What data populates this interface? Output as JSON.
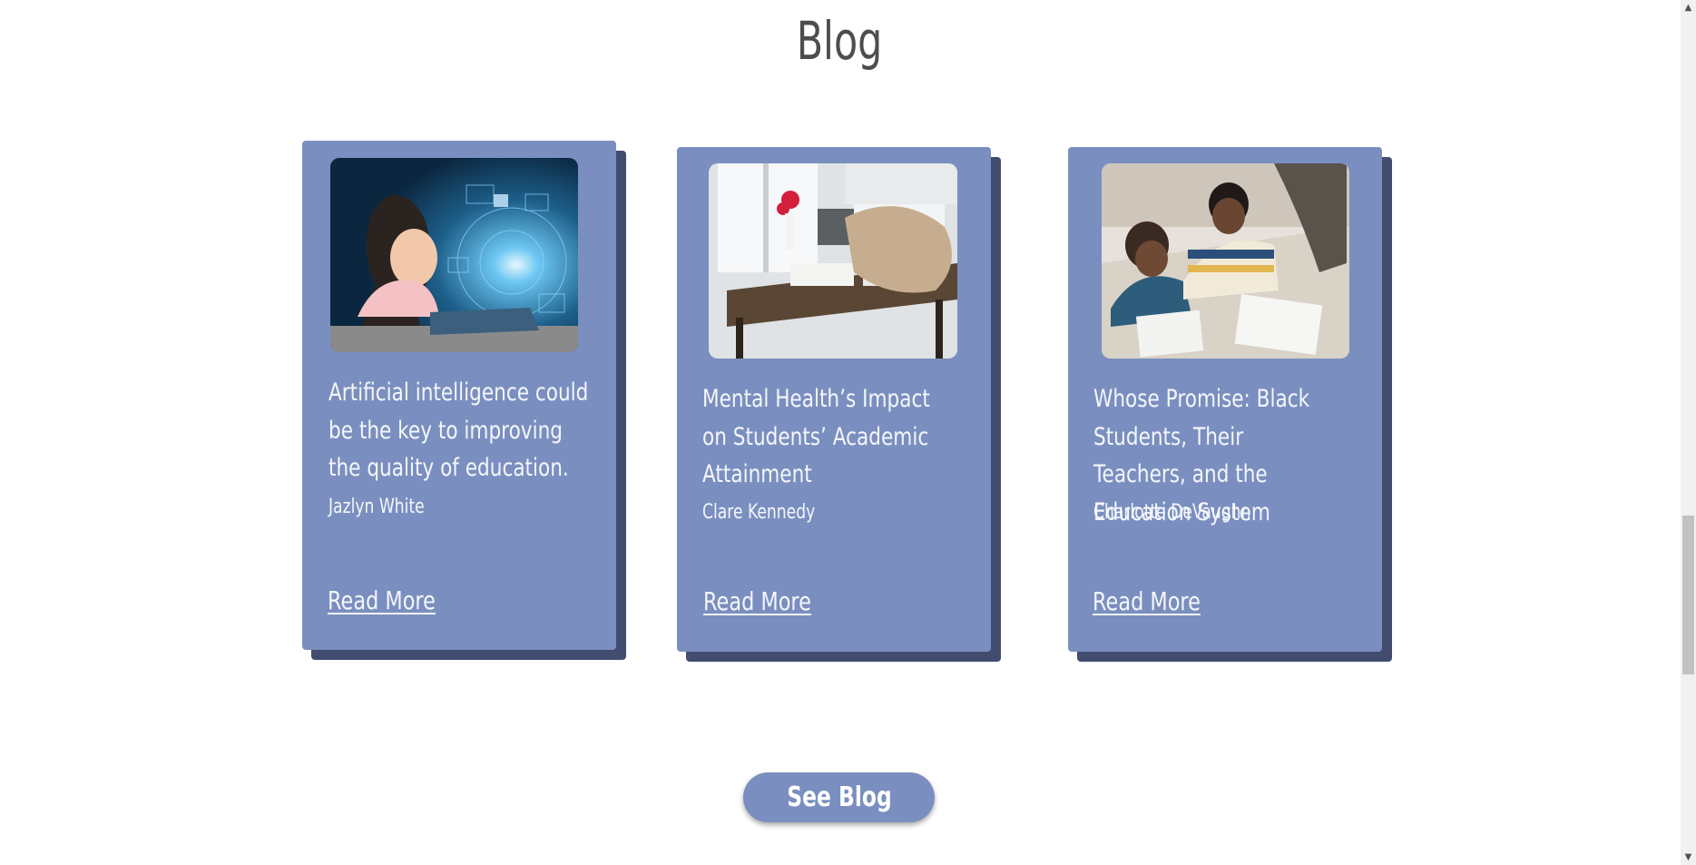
{
  "section": {
    "title": "Blog"
  },
  "posts": [
    {
      "title": "Artificial intelligence could be the key to improving the quality of education.",
      "author": "Jazlyn White",
      "link_label": "Read More",
      "image_icon": "child-with-ai-laptop-image"
    },
    {
      "title": "Mental Health’s Impact on Students’ Academic Attainment",
      "author": "Clare Kennedy",
      "link_label": "Read More",
      "image_icon": "student-resting-on-desk-image"
    },
    {
      "title": "Whose Promise: Black Students, Their Teachers, and the Education System",
      "author": "Charlotte DeVaughn",
      "link_label": "Read More",
      "image_icon": "students-writing-with-teacher-image"
    }
  ],
  "cta": {
    "label": "See Blog"
  },
  "colors": {
    "card": "#7a8fbf",
    "card_shadow": "#414c6e",
    "title": "#4d4d4d",
    "card_text": "#f4f6fb"
  }
}
